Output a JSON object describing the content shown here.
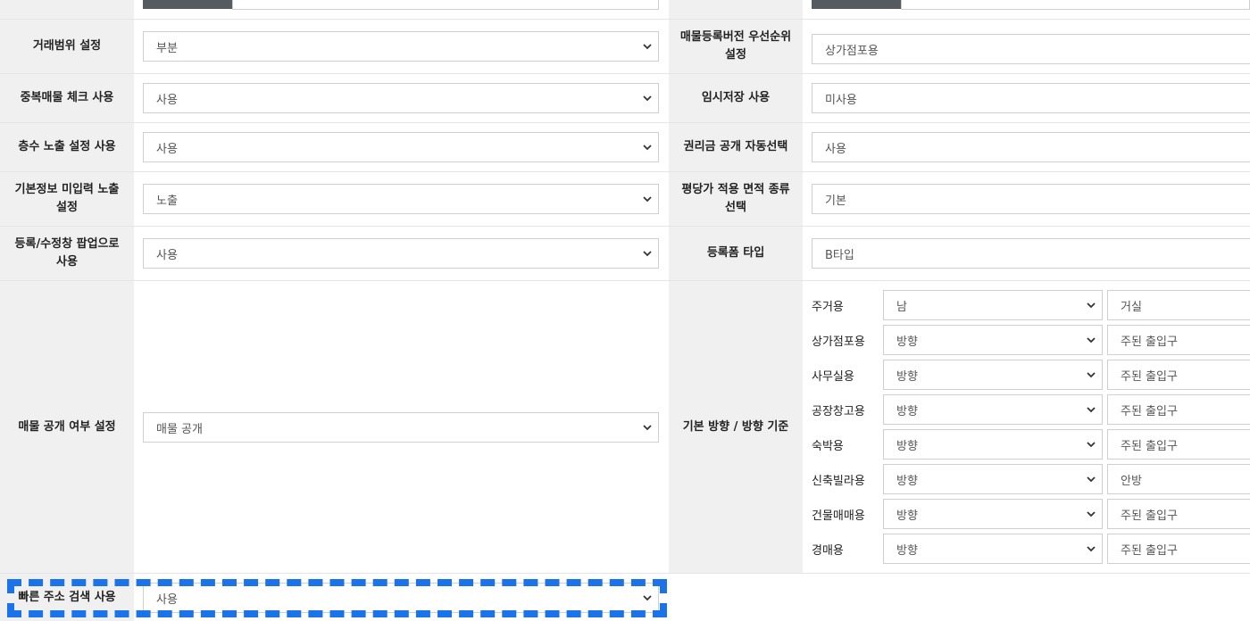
{
  "left_rows": [
    {
      "label": "거래범위 설정",
      "value": "부분"
    },
    {
      "label": "중복매물 체크 사용",
      "value": "사용"
    },
    {
      "label": "층수 노출 설정 사용",
      "value": "사용"
    },
    {
      "label": "기본정보 미입력 노출 설정",
      "value": "노출"
    },
    {
      "label": "등록/수정창 팝업으로 사용",
      "value": "사용"
    },
    {
      "label": "매물 공개 여부 설정",
      "value": "매물 공개"
    },
    {
      "label": "빠른 주소 검색 사용",
      "value": "사용"
    }
  ],
  "right_rows": [
    {
      "label": "매물등록버전 우선순위설정",
      "value": "상가점포용"
    },
    {
      "label": "임시저장 사용",
      "value": "미사용"
    },
    {
      "label": "권리금 공개 자동선택",
      "value": "사용"
    },
    {
      "label": "평당가 적용 면적 종류 선택",
      "value": "기본"
    },
    {
      "label": "등록폼 타입",
      "value": "B타입"
    }
  ],
  "direction": {
    "label": "기본 방향 / 방향 기준",
    "rows": [
      {
        "type": "주거용",
        "direction": "남",
        "basis": "거실"
      },
      {
        "type": "상가점포용",
        "direction": "방향",
        "basis": "주된 출입구"
      },
      {
        "type": "사무실용",
        "direction": "방향",
        "basis": "주된 출입구"
      },
      {
        "type": "공장창고용",
        "direction": "방향",
        "basis": "주된 출입구"
      },
      {
        "type": "숙박용",
        "direction": "방향",
        "basis": "주된 출입구"
      },
      {
        "type": "신축빌라용",
        "direction": "방향",
        "basis": "안방"
      },
      {
        "type": "건물매매용",
        "direction": "방향",
        "basis": "주된 출입구"
      },
      {
        "type": "경매용",
        "direction": "방향",
        "basis": "주된 출입구"
      }
    ]
  },
  "colors": {
    "label_bg": "#f0f0f0",
    "highlight": "#1a73e8",
    "button": "#555b61"
  },
  "icons": {
    "dropdown": "chevron-down-icon"
  }
}
